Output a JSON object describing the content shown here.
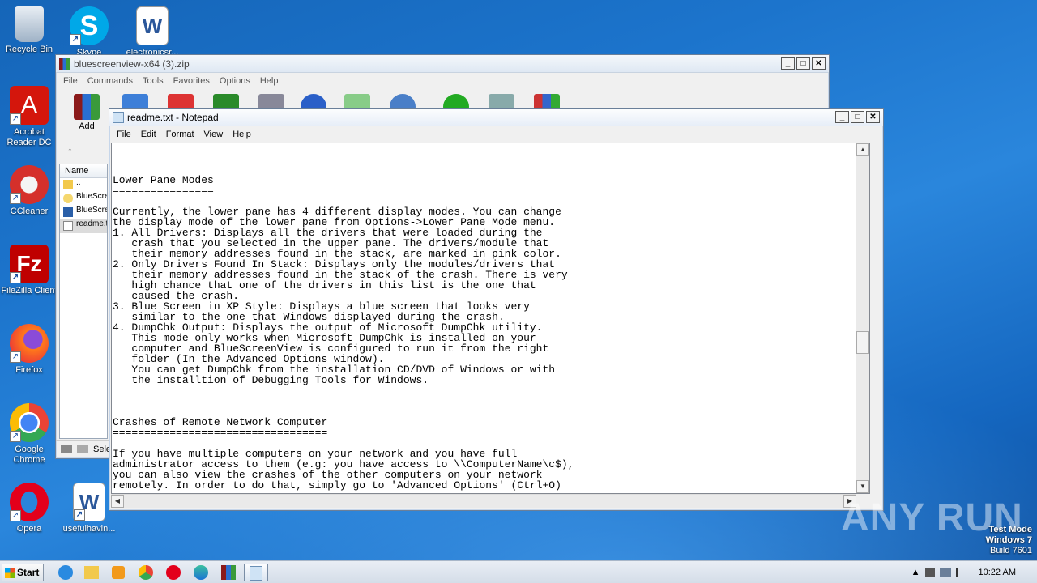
{
  "desktop": {
    "icons": [
      {
        "label": "Recycle Bin",
        "icon": "recycle-bin-icon"
      },
      {
        "label": "Skype",
        "icon": "skype-icon"
      },
      {
        "label": "electronicsr...",
        "icon": "word-doc-icon"
      },
      {
        "label": "Acrobat Reader DC",
        "icon": "acrobat-icon"
      },
      {
        "label": "CCleaner",
        "icon": "ccleaner-icon"
      },
      {
        "label": "FileZilla Client",
        "icon": "filezilla-icon"
      },
      {
        "label": "Firefox",
        "icon": "firefox-icon"
      },
      {
        "label": "Google Chrome",
        "icon": "chrome-icon"
      },
      {
        "label": "Opera",
        "icon": "opera-icon"
      },
      {
        "label": "usefulhavin...",
        "icon": "word-doc-icon"
      }
    ]
  },
  "winrar": {
    "title": "bluescreenview-x64 (3).zip",
    "menu": [
      "File",
      "Commands",
      "Tools",
      "Favorites",
      "Options",
      "Help"
    ],
    "toolbar_add_label": "Add",
    "column_name": "Name",
    "files": [
      {
        "name": "..",
        "icon": "folder-up-icon"
      },
      {
        "name": "BlueScreenView.chm",
        "icon": "help-file-icon"
      },
      {
        "name": "BlueScreenView.exe",
        "icon": "exe-icon"
      },
      {
        "name": "readme.txt",
        "icon": "text-file-icon"
      }
    ],
    "status_select": "Sele"
  },
  "notepad": {
    "title": "readme.txt - Notepad",
    "menu": [
      "File",
      "Edit",
      "Format",
      "View",
      "Help"
    ],
    "lines": [
      "",
      "",
      "",
      "Lower Pane Modes",
      "================",
      "",
      "Currently, the lower pane has 4 different display modes. You can change",
      "the display mode of the lower pane from Options->Lower Pane Mode menu.",
      "1. All Drivers: Displays all the drivers that were loaded during the",
      "   crash that you selected in the upper pane. The drivers/module that",
      "   their memory addresses found in the stack, are marked in pink color.",
      "2. Only Drivers Found In Stack: Displays only the modules/drivers that",
      "   their memory addresses found in the stack of the crash. There is very",
      "   high chance that one of the drivers in this list is the one that",
      "   caused the crash.",
      "3. Blue Screen in XP Style: Displays a blue screen that looks very",
      "   similar to the one that Windows displayed during the crash.",
      "4. DumpChk Output: Displays the output of Microsoft DumpChk utility.",
      "   This mode only works when Microsoft DumpChk is installed on your",
      "   computer and BlueScreenView is configured to run it from the right",
      "   folder (In the Advanced Options window).",
      "   You can get DumpChk from the installation CD/DVD of Windows or with",
      "   the installtion of Debugging Tools for Windows.",
      "",
      "",
      "",
      "Crashes of Remote Network Computer",
      "==================================",
      "",
      "If you have multiple computers on your network and you have full",
      "administrator access to them (e.g: you have access to \\\\ComputerName\\c$),",
      "you can also view the crashes of the other computers on your network",
      "remotely. In order to do that, simply go to 'Advanced Options' (Ctrl+O)"
    ],
    "scroll_position": 0.58
  },
  "taskbar": {
    "start_label": "Start",
    "apps": [
      "ie-icon",
      "explorer-icon",
      "media-player-icon",
      "chrome-icon",
      "opera-icon",
      "edge-icon",
      "winrar-icon",
      "notepad-icon"
    ],
    "clock": "10:22 AM"
  },
  "watermark": {
    "line1": "Test Mode",
    "line2": "Windows 7",
    "line3": "Build 7601"
  },
  "brand": "ANY RUN"
}
